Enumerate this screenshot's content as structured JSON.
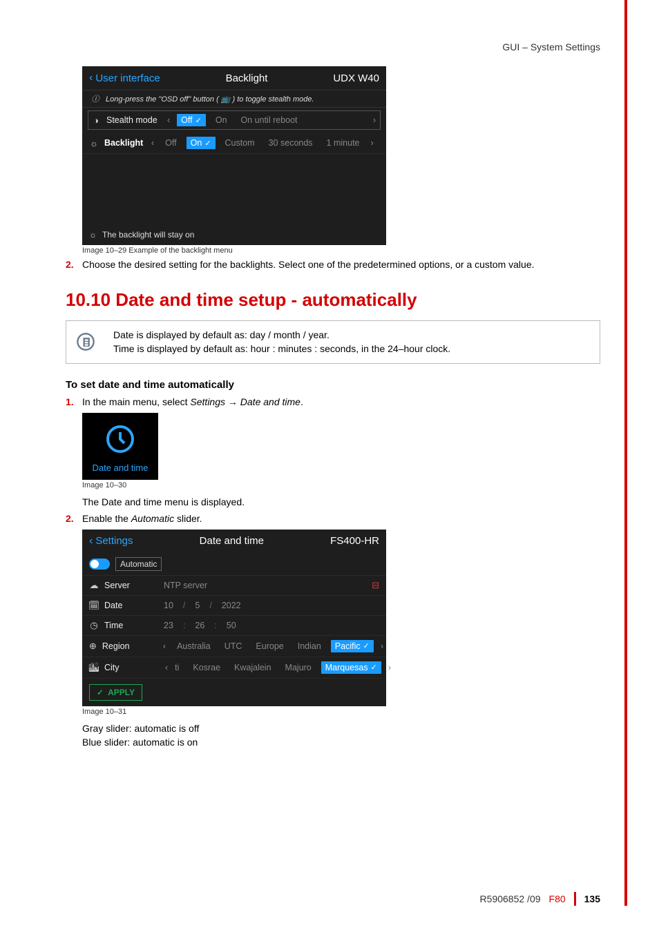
{
  "header_right": "GUI – System Settings",
  "panel_backlight": {
    "back_label": "User interface",
    "title": "Backlight",
    "model": "UDX W40",
    "info_line": "Long-press the \"OSD off\" button (  📺  ) to toggle stealth mode.",
    "stealth": {
      "label": "Stealth mode",
      "opts": [
        "Off",
        "On",
        "On until reboot"
      ],
      "selected": "Off"
    },
    "backlight": {
      "label": "Backlight",
      "opts": [
        "Off",
        "On",
        "Custom",
        "30 seconds",
        "1 minute"
      ],
      "selected": "On"
    },
    "footer_hint": "The backlight will stay on",
    "caption": "Image 10–29  Example of the backlight menu"
  },
  "step2_a": "Choose the desired setting for the backlights. Select one of the predetermined options, or a custom value.",
  "section_title": "10.10 Date and time setup - automatically",
  "note": {
    "line1": "Date is displayed by default as: day / month / year.",
    "line2": "Time is displayed by default as: hour : minutes : seconds, in the 24–hour clock."
  },
  "subhead": "To set date and time automatically",
  "step1_b_pre": "In the main menu, select ",
  "step1_b_em": "Settings → Date and time",
  "tile_label": "Date and time",
  "caption_30": "Image 10–30",
  "after_tile": "The Date and time menu is displayed.",
  "step2_b_pre": "Enable the ",
  "step2_b_em": "Automatic",
  "step2_b_post": " slider.",
  "panel_datetime": {
    "back_label": "Settings",
    "title": "Date and time",
    "model": "FS400-HR",
    "toggle_label": "Automatic",
    "server_label": "Server",
    "server_placeholder": "NTP server",
    "date_label": "Date",
    "date": {
      "d": "10",
      "m": "5",
      "y": "2022"
    },
    "time_label": "Time",
    "time": {
      "h": "23",
      "min": "26",
      "s": "50"
    },
    "region_label": "Region",
    "region_opts": [
      "Australia",
      "UTC",
      "Europe",
      "Indian",
      "Pacific"
    ],
    "region_selected": "Pacific",
    "city_label": "City",
    "city_prefix": "ti",
    "city_opts": [
      "Kosrae",
      "Kwajalein",
      "Majuro",
      "Marquesas"
    ],
    "city_selected": "Marquesas",
    "apply": "APPLY",
    "caption": "Image 10–31"
  },
  "gray_line": "Gray slider: automatic is off",
  "blue_line": "Blue slider: automatic is on",
  "footer": {
    "doc": "R5906852 /09",
    "prod": "F80",
    "page": "135"
  }
}
